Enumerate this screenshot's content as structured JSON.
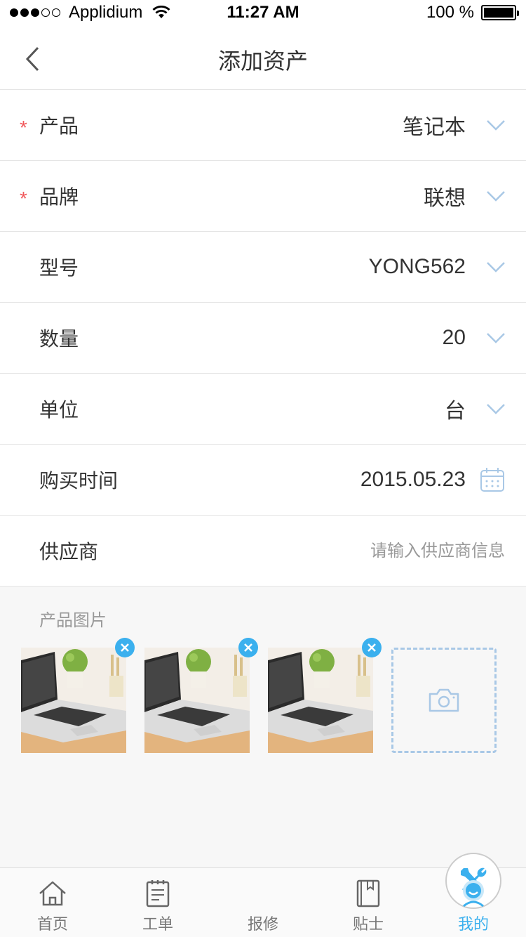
{
  "status_bar": {
    "carrier": "Applidium",
    "time": "11:27 AM",
    "battery": "100 %"
  },
  "nav": {
    "title": "添加资产"
  },
  "form": {
    "rows": [
      {
        "label": "产品",
        "value": "笔记本",
        "required": "*"
      },
      {
        "label": "品牌",
        "value": "联想",
        "required": "*"
      },
      {
        "label": "型号",
        "value": "YONG562"
      },
      {
        "label": "数量",
        "value": "20"
      },
      {
        "label": "单位",
        "value": "台"
      },
      {
        "label": "购买时间",
        "value": "2015.05.23"
      },
      {
        "label": "供应商",
        "placeholder": "请输入供应商信息",
        "value": ""
      }
    ]
  },
  "photos": {
    "title": "产品图片",
    "count": 3
  },
  "tab_bar": {
    "tabs": [
      {
        "label": "首页"
      },
      {
        "label": "工单"
      },
      {
        "label": "报修"
      },
      {
        "label": "贴士"
      },
      {
        "label": "我的"
      }
    ],
    "active": "我的"
  },
  "colors": {
    "accent": "#3bb0ee",
    "required": "#f0585b",
    "chevron": "#a9c8e6"
  }
}
